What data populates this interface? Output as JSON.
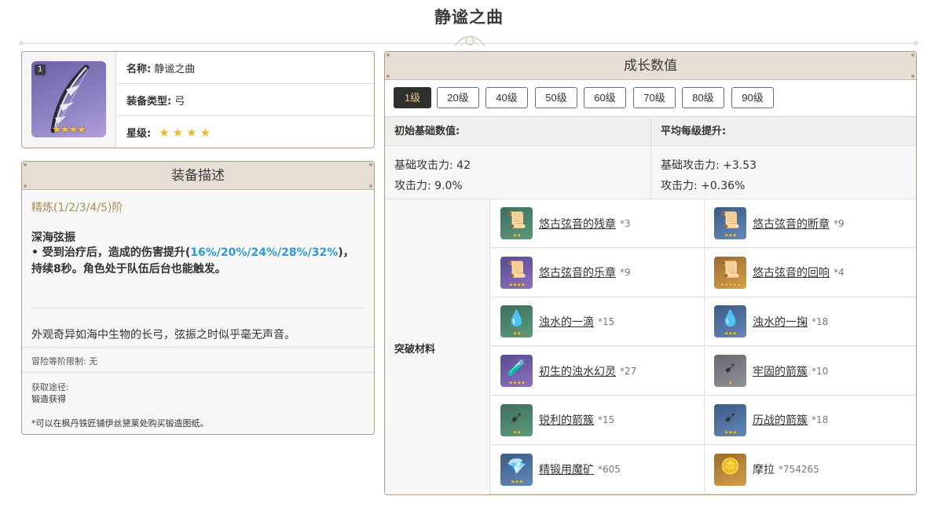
{
  "page": {
    "title": "静谧之曲"
  },
  "info": {
    "refine_badge": "1",
    "name_label": "名称:",
    "name_value": "静谧之曲",
    "type_label": "装备类型:",
    "type_value": "弓",
    "rarity_label": "星级:",
    "rarity_stars": [
      "★",
      "★",
      "★",
      "★"
    ],
    "icon_stars": "★★★★"
  },
  "description": {
    "header": "装备描述",
    "refine": "精炼(1/2/3/4/5)阶",
    "skill_name": "深海弦振",
    "skill_text_1": " • 受到治疗后，造成的伤害提升(",
    "skill_text_hl": "16%/20%/24%/28%/32%",
    "skill_text_2": ")，持续8秒。角色处于队伍后台也能触发。",
    "flavor": "外观奇异如海中生物的长弓，弦振之时似乎毫无声音。",
    "adventure_limit": "冒险等阶限制: 无",
    "source_label": "获取途径:",
    "source_value": "锻造获得",
    "note": "*可以在枫丹铁匠铺伊丝黛莱处购买锻造图纸。"
  },
  "growth": {
    "header": "成长数值",
    "levels": [
      "1级",
      "20级",
      "40级",
      "50级",
      "60级",
      "70级",
      "80级",
      "90级"
    ],
    "active_level": "1级",
    "initial_header": "初始基础数值:",
    "per_level_header": "平均每级提升:",
    "initial_atk": "基础攻击力: 42",
    "initial_sub": "攻击力: 9.0%",
    "per_level_atk": "基础攻击力: +3.53",
    "per_level_sub": "攻击力: +0.36%",
    "materials_label": "突破材料",
    "materials": [
      {
        "name": "悠古弦音的残章",
        "count": "*3",
        "stars": "★★",
        "icon": "scroll-icon",
        "glyph": "📜"
      },
      {
        "name": "悠古弦音的断章",
        "count": "*9",
        "stars": "★★★",
        "icon": "scroll-icon",
        "glyph": "📜"
      },
      {
        "name": "悠古弦音的乐章",
        "count": "*9",
        "stars": "★★★★",
        "icon": "scroll-icon",
        "glyph": "📜"
      },
      {
        "name": "悠古弦音的回响",
        "count": "*4",
        "stars": "★★★★★",
        "icon": "scroll-icon",
        "glyph": "📜"
      },
      {
        "name": "浊水的一滴",
        "count": "*15",
        "stars": "★★",
        "icon": "droplet-icon",
        "glyph": "💧"
      },
      {
        "name": "浊水的一掬",
        "count": "*18",
        "stars": "★★★",
        "icon": "droplet-icon",
        "glyph": "💧"
      },
      {
        "name": "初生的浊水幻灵",
        "count": "*27",
        "stars": "★★★★",
        "icon": "flask-icon",
        "glyph": "🧪"
      },
      {
        "name": "牢固的箭簇",
        "count": "*10",
        "stars": "★",
        "icon": "arrowhead-icon",
        "glyph": "➹"
      },
      {
        "name": "锐利的箭簇",
        "count": "*15",
        "stars": "★★",
        "icon": "arrowhead-icon",
        "glyph": "➹"
      },
      {
        "name": "历战的箭簇",
        "count": "*18",
        "stars": "★★★",
        "icon": "arrowhead-icon",
        "glyph": "➹"
      },
      {
        "name": "精锻用魔矿",
        "count": "*605",
        "stars": "★★★",
        "icon": "crystal-ore-icon",
        "glyph": "💎"
      },
      {
        "name": "摩拉",
        "count": "*754265",
        "stars": "",
        "icon": "mora-coin-icon",
        "glyph": "🪙"
      }
    ]
  },
  "colors": {
    "border": "#b39c86",
    "header_bg": "#e5dfd5",
    "refine_text": "#a98b56",
    "highlight": "#2f9ad8",
    "active_level_bg": "#2f2f2f",
    "active_level_text": "#e7c78b",
    "star": "#f2b52f"
  }
}
